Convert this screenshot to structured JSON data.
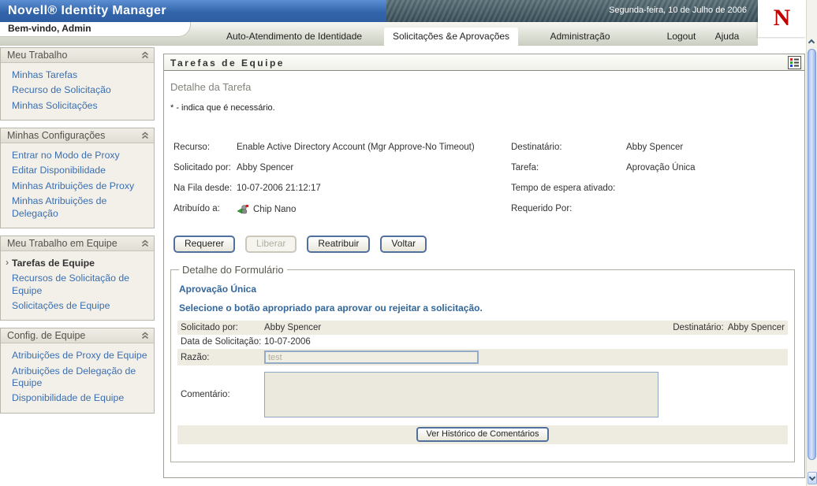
{
  "colors": {
    "header_blue": "#3365ab",
    "band_teal": "#4a626c",
    "novell_red": "#c00000",
    "link_blue": "#3b6eb0",
    "accent_text_blue": "#336699",
    "stripe_beige": "#eeebe1",
    "scroll_thumb_blue": "#9fbcf0"
  },
  "header": {
    "brand": "Novell® Identity Manager",
    "date": "Segunda-feira, 10 de Julho de 2006",
    "welcome": "Bem-vindo, Admin",
    "logo_letter": "N",
    "tabs": [
      {
        "label": "Auto-Atendimento de Identidade",
        "active": false
      },
      {
        "label": "Solicitações &e Aprovações",
        "active": true
      },
      {
        "label": "Administração",
        "active": false
      },
      {
        "label": "Logout",
        "active": false
      },
      {
        "label": "Ajuda",
        "active": false
      }
    ]
  },
  "sidebar": {
    "sections": [
      {
        "title": "Meu Trabalho",
        "items": [
          {
            "label": "Minhas Tarefas",
            "active": false
          },
          {
            "label": "Recurso de Solicitação",
            "active": false
          },
          {
            "label": "Minhas Solicitações",
            "active": false
          }
        ]
      },
      {
        "title": "Minhas Configurações",
        "items": [
          {
            "label": "Entrar no Modo de Proxy",
            "active": false
          },
          {
            "label": "Editar Disponibilidade",
            "active": false
          },
          {
            "label": "Minhas Atribuições de Proxy",
            "active": false
          },
          {
            "label": "Minhas Atribuições de Delegação",
            "active": false
          }
        ]
      },
      {
        "title": "Meu Trabalho em Equipe",
        "items": [
          {
            "label": "Tarefas de Equipe",
            "active": true
          },
          {
            "label": "Recursos de Solicitação de Equipe",
            "active": false
          },
          {
            "label": "Solicitações de Equipe",
            "active": false
          }
        ]
      },
      {
        "title": "Config. de Equipe",
        "items": [
          {
            "label": "Atribuições de Proxy de Equipe",
            "active": false
          },
          {
            "label": "Atribuições de Delegação de Equipe",
            "active": false
          },
          {
            "label": "Disponibilidade de Equipe",
            "active": false
          }
        ]
      }
    ]
  },
  "main": {
    "title": "Tarefas de Equipe",
    "subtitle": "Detalhe da Tarefa",
    "required_note": "* - indica que é necessário.",
    "details": {
      "left": [
        {
          "label": "Recurso:",
          "value": "Enable Active Directory Account (Mgr Approve-No Timeout)"
        },
        {
          "label": "Solicitado por:",
          "value": "Abby Spencer"
        },
        {
          "label": "Na Fila desde:",
          "value": "10-07-2006 21:12:17"
        },
        {
          "label": "Atribuído a:",
          "value": "Chip Nano"
        }
      ],
      "right": [
        {
          "label": "Destinatário:",
          "value": "Abby Spencer"
        },
        {
          "label": "Tarefa:",
          "value": "Aprovação Única"
        },
        {
          "label": "Tempo de espera ativado:",
          "value": ""
        },
        {
          "label": "Requerido Por:",
          "value": ""
        }
      ]
    },
    "actions": [
      {
        "label": "Requerer",
        "enabled": true
      },
      {
        "label": "Liberar",
        "enabled": false
      },
      {
        "label": "Reatribuir",
        "enabled": true
      },
      {
        "label": "Voltar",
        "enabled": true
      }
    ],
    "form": {
      "legend": "Detalhe do Formulário",
      "heading": "Aprovação Única",
      "instruction": "Selecione o botão apropriado para aprovar ou rejeitar a solicitação.",
      "solicitado_label": "Solicitado por:",
      "solicitado_value": "Abby Spencer",
      "destinatario_label": "Destinatário:",
      "destinatario_value": "Abby Spencer",
      "data_label": "Data de Solicitação:",
      "data_value": "10-07-2006",
      "razao_label": "Razão:",
      "razao_value": "test",
      "comentario_label": "Comentário:",
      "comentario_value": "",
      "history_button": "Ver Histórico de Comentários"
    }
  }
}
